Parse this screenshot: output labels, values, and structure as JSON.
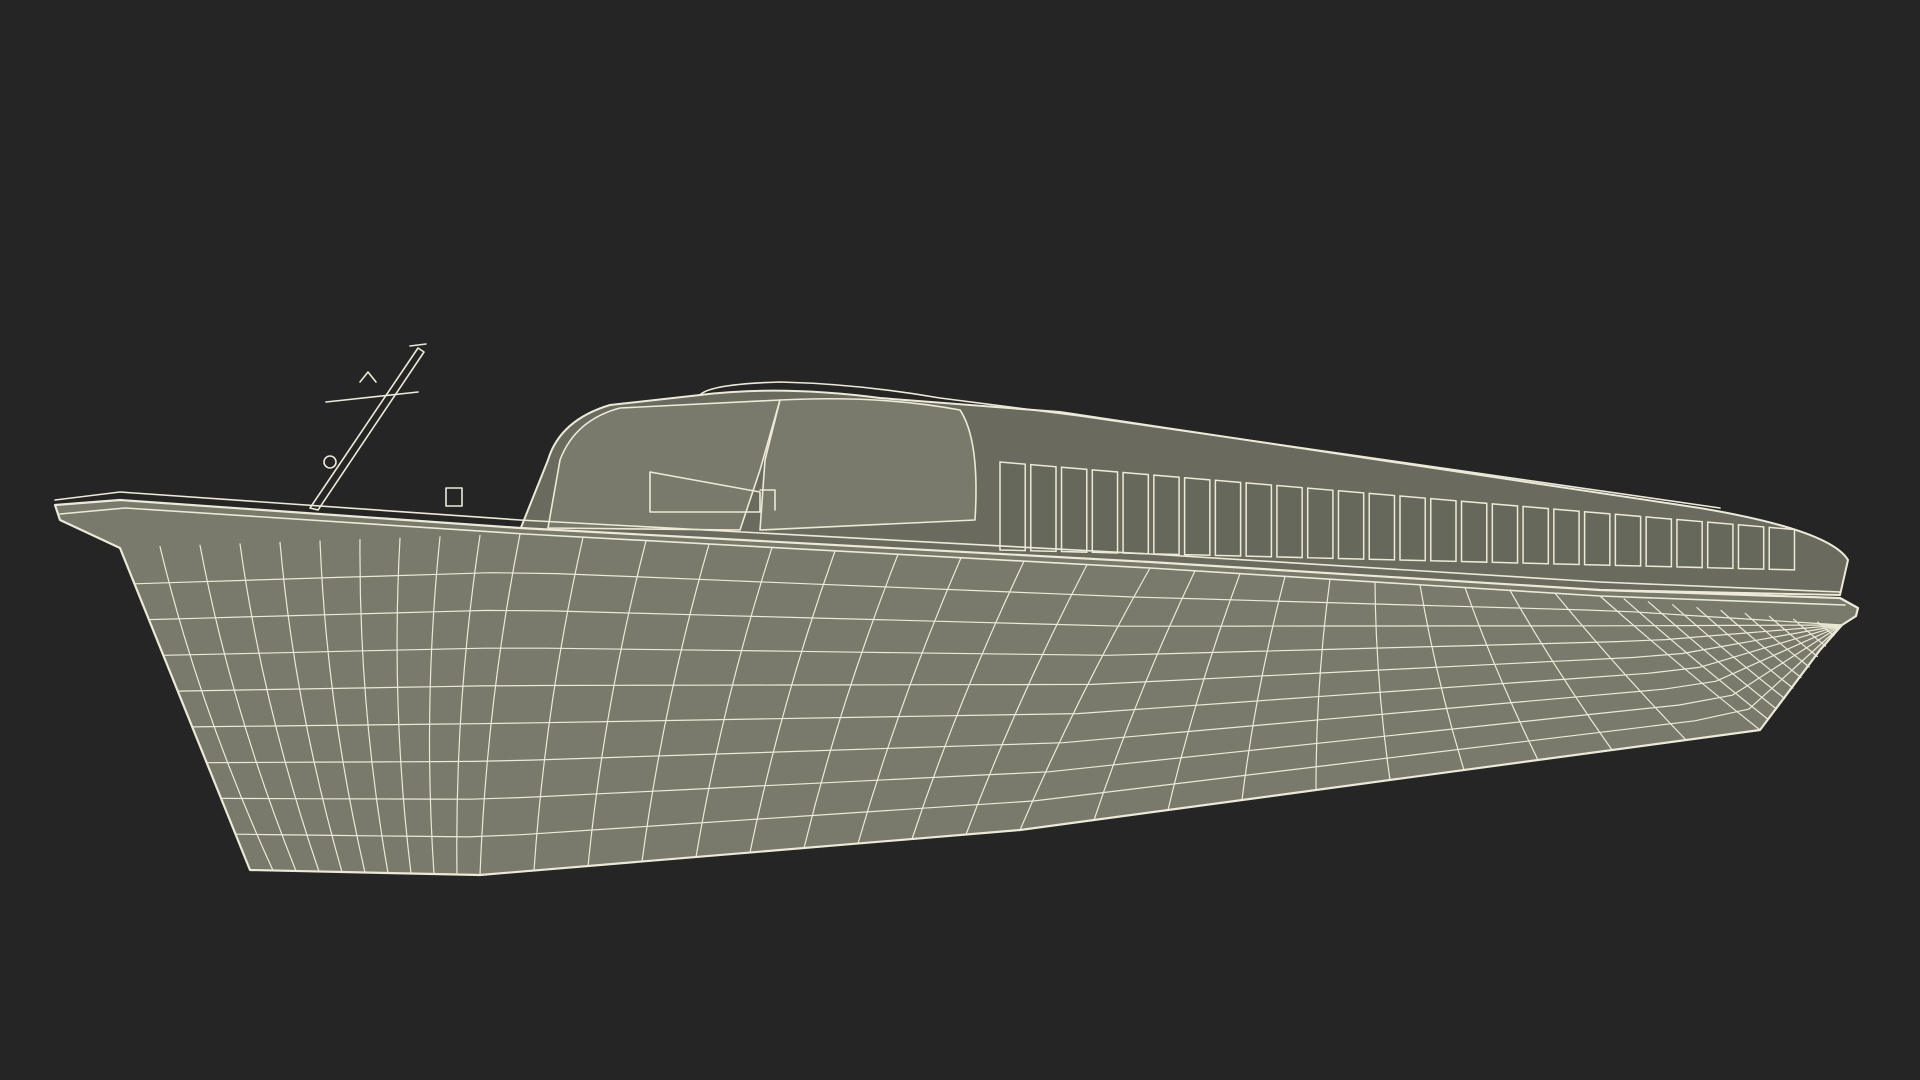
{
  "scene": {
    "subject": "boat-wireframe",
    "colors": {
      "background": "#252525",
      "surface": "#797a6c",
      "surface_dark": "#6a6b5e",
      "wire": "#ece9d6",
      "window": "#67685c"
    }
  }
}
